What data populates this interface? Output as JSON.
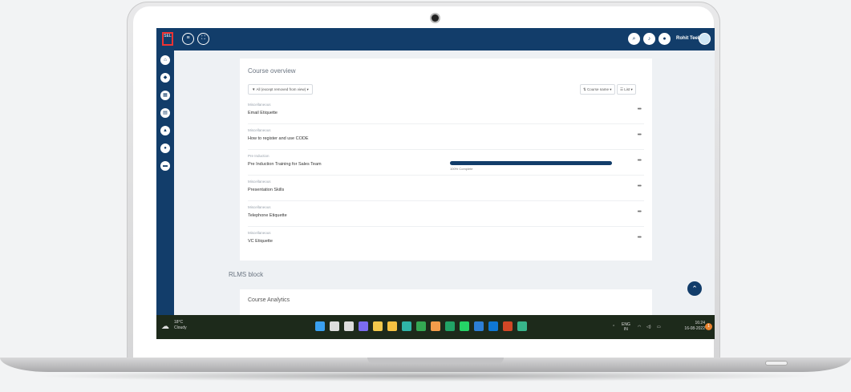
{
  "topbar": {
    "logo_text": "SEL",
    "menu_icon": "hamburger-icon",
    "fullscreen_icon": "fullscreen-icon",
    "search_icon": "search-icon",
    "bell_icon": "bell-icon",
    "chat_icon": "chat-icon",
    "user_name": "Rohit Teel"
  },
  "sidebar": {
    "items": [
      "home-icon",
      "dashboard-icon",
      "calendar-icon",
      "courses-icon",
      "reports-icon",
      "messages-icon",
      "folder-icon"
    ]
  },
  "course_overview": {
    "title": "Course overview",
    "filter_label": "All (except removed from view) ▾",
    "sort_label": "Course name ▾",
    "view_label": "List ▾",
    "courses": [
      {
        "category": "Miscellaneous",
        "name": "Email Etiquette",
        "progress_text": "",
        "progress": null
      },
      {
        "category": "Miscellaneous",
        "name": "How to register and use CODE",
        "progress_text": "",
        "progress": null
      },
      {
        "category": "Pre Induction",
        "name": "Pre Induction Training for Sales Team",
        "progress_text": "100% Complete",
        "progress": 1.0
      },
      {
        "category": "Miscellaneous",
        "name": "Presentation Skills",
        "progress_text": "",
        "progress": null
      },
      {
        "category": "Miscellaneous",
        "name": "Telephone Etiquette",
        "progress_text": "",
        "progress": null
      },
      {
        "category": "Miscellaneous",
        "name": "VC Etiquette",
        "progress_text": "",
        "progress": null
      }
    ],
    "more_icon": "•••"
  },
  "rlms": {
    "title": "RLMS block"
  },
  "analytics": {
    "title": "Course Analytics"
  },
  "scroll_top_icon": "chevron-up-icon",
  "taskbar": {
    "temperature": "18°C",
    "condition": "Cloudy",
    "lang": "ENG",
    "region": "IN",
    "time": "16:24",
    "date": "16-08-2022",
    "notification_count": "1",
    "apps": [
      {
        "name": "start-icon",
        "color": "#3aa0f0"
      },
      {
        "name": "search-icon",
        "color": "#dddddd"
      },
      {
        "name": "task-view-icon",
        "color": "#dddddd"
      },
      {
        "name": "chat-icon",
        "color": "#7b6cf0"
      },
      {
        "name": "sticky-notes-icon",
        "color": "#f2c94c"
      },
      {
        "name": "file-explorer-icon",
        "color": "#f5c242"
      },
      {
        "name": "edge-icon",
        "color": "#2fb5a8"
      },
      {
        "name": "chrome-icon",
        "color": "#34a853"
      },
      {
        "name": "paint-icon",
        "color": "#f39c4a"
      },
      {
        "name": "excel-icon",
        "color": "#21a366"
      },
      {
        "name": "whatsapp-icon",
        "color": "#25d366"
      },
      {
        "name": "photos-icon",
        "color": "#2d7fd6"
      },
      {
        "name": "outlook-icon",
        "color": "#0f78d4"
      },
      {
        "name": "powerpoint-icon",
        "color": "#d24726"
      },
      {
        "name": "vpn-icon",
        "color": "#38b48b"
      }
    ]
  }
}
